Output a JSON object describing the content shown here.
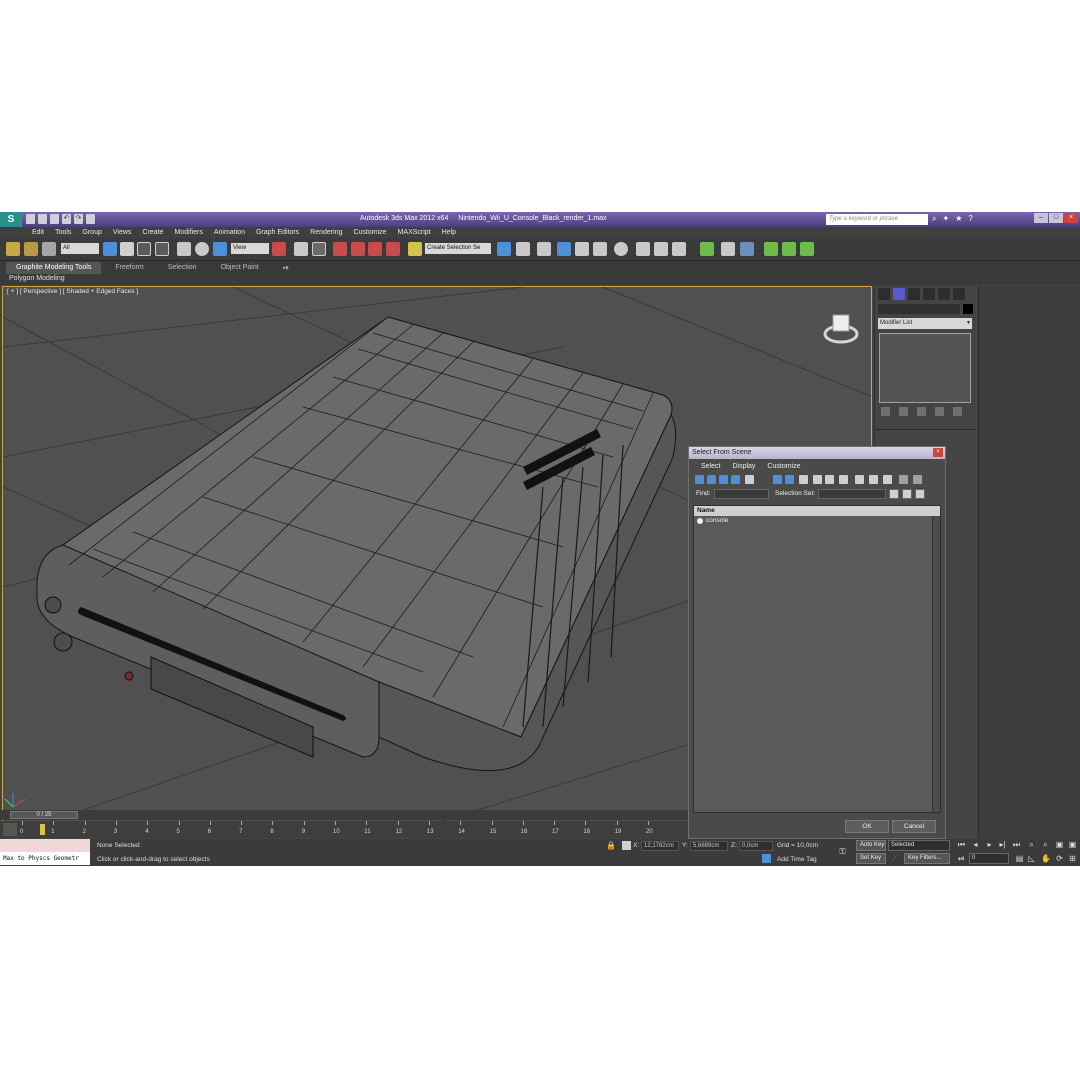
{
  "window": {
    "title": "Autodesk 3ds Max  2012 x64",
    "file": "Nintendo_Wii_U_Console_Black_render_1.max",
    "search_placeholder": "Type a keyword or phrase"
  },
  "menu": [
    "Edit",
    "Tools",
    "Group",
    "Views",
    "Create",
    "Modifiers",
    "Animation",
    "Graph Editors",
    "Rendering",
    "Customize",
    "MAXScript",
    "Help"
  ],
  "toolbar": {
    "selection_filter": "All",
    "reference_coord": "View",
    "named_selection": "Create Selection Se"
  },
  "ribbon": {
    "tabs": [
      "Graphite Modeling Tools",
      "Freeform",
      "Selection",
      "Object Paint"
    ],
    "active_tab": "Graphite Modeling Tools",
    "sub_label": "Polygon Modeling"
  },
  "viewport": {
    "label": "[ + ] [ Perspective ] [ Shaded + Edged Faces ]"
  },
  "command_panel": {
    "modifier_list": "Modifier List"
  },
  "dialog": {
    "title": "Select From Scene",
    "menu": [
      "Select",
      "Display",
      "Customize"
    ],
    "find_label": "Find:",
    "selection_set_label": "Selection Set:",
    "column_name": "Name",
    "items": [
      "console"
    ],
    "ok": "OK",
    "cancel": "Cancel"
  },
  "timeline": {
    "frame": "0 / 25",
    "ticks": [
      "0",
      "1",
      "2",
      "3",
      "4",
      "5",
      "6",
      "7",
      "8",
      "9",
      "10",
      "11",
      "12",
      "13",
      "14",
      "15",
      "16",
      "17",
      "18",
      "19",
      "20"
    ]
  },
  "status": {
    "listener": "Max to Physcs Geometr",
    "selection": "None Selected",
    "prompt": "Click or click-and-drag to select objects",
    "x_label": "X:",
    "x_value": "12,1782cm",
    "y_label": "Y:",
    "y_value": "5,6889cm",
    "z_label": "Z:",
    "z_value": "0,0cm",
    "grid": "Grid = 10,0cm",
    "add_time_tag": "Add Time Tag",
    "auto_key": "Auto Key",
    "set_key": "Set Key",
    "key_mode": "Selected",
    "key_filters": "Key Filters...",
    "current_frame": "0"
  }
}
